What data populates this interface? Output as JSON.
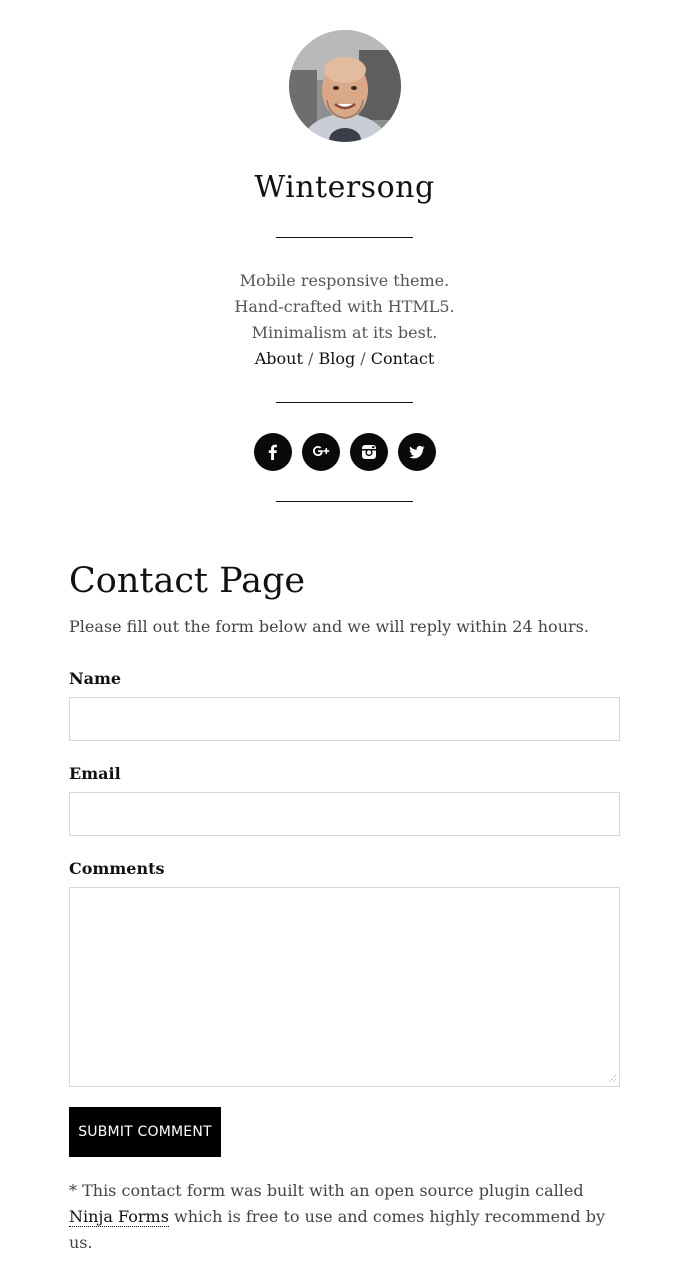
{
  "site": {
    "title": "Wintersong",
    "tagline": [
      "Mobile responsive theme.",
      "Hand-crafted with HTML5.",
      "Minimalism at its best."
    ],
    "nav": [
      {
        "label": "About"
      },
      {
        "label": "Blog"
      },
      {
        "label": "Contact"
      }
    ],
    "nav_separator": " / ",
    "social": [
      {
        "icon": "facebook-icon"
      },
      {
        "icon": "google-plus-icon"
      },
      {
        "icon": "instagram-icon"
      },
      {
        "icon": "twitter-icon"
      }
    ]
  },
  "page": {
    "title": "Contact Page",
    "intro": "Please fill out the form below and we will reply within 24 hours."
  },
  "form": {
    "name_label": "Name",
    "name_value": "",
    "email_label": "Email",
    "email_value": "",
    "comments_label": "Comments",
    "comments_value": "",
    "submit_label": "SUBMIT COMMENT"
  },
  "footnote": {
    "before": "* This contact form was built with an open source plugin called ",
    "link": "Ninja Forms",
    "after": " which is free to use and comes highly recommend by us."
  },
  "colors": {
    "text": "#111111",
    "muted": "#555555",
    "button_bg": "#000000",
    "input_border": "#d8d8d8"
  }
}
